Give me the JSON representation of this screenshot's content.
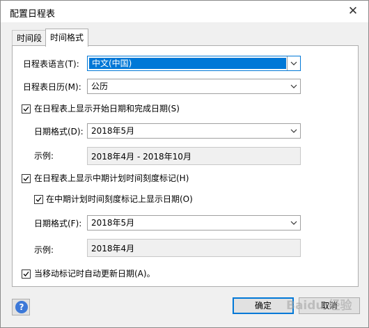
{
  "window": {
    "title": "配置日程表"
  },
  "tabs": [
    {
      "label": "时间段",
      "active": false
    },
    {
      "label": "时间格式",
      "active": true
    }
  ],
  "form": {
    "language": {
      "label": "日程表语言(T):",
      "value": "中文(中国)"
    },
    "calendar": {
      "label": "日程表日历(M):",
      "value": "公历"
    },
    "show_dates": {
      "label": "在日程表上显示开始日期和完成日期(S)",
      "checked": true
    },
    "date_format_1": {
      "label": "日期格式(D):",
      "value": "2018年5月"
    },
    "example_1": {
      "label": "示例:",
      "value": "2018年4月 - 2018年10月"
    },
    "show_midpoint_ticks": {
      "label": "在日程表上显示中期计划时间刻度标记(H)",
      "checked": true
    },
    "show_dates_on_ticks": {
      "label": "在中期计划时间刻度标记上显示日期(O)",
      "checked": true
    },
    "date_format_2": {
      "label": "日期格式(F):",
      "value": "2018年5月"
    },
    "example_2": {
      "label": "示例:",
      "value": "2018年4月"
    },
    "auto_update": {
      "label": "当移动标记时自动更新日期(A)。",
      "checked": true
    }
  },
  "footer": {
    "ok_label": "确定",
    "cancel_label": "取消",
    "help_symbol": "?"
  },
  "watermark": "Baidu 经验",
  "colors": {
    "selection": "#0078d7",
    "help_icon": "#3c78d8"
  }
}
